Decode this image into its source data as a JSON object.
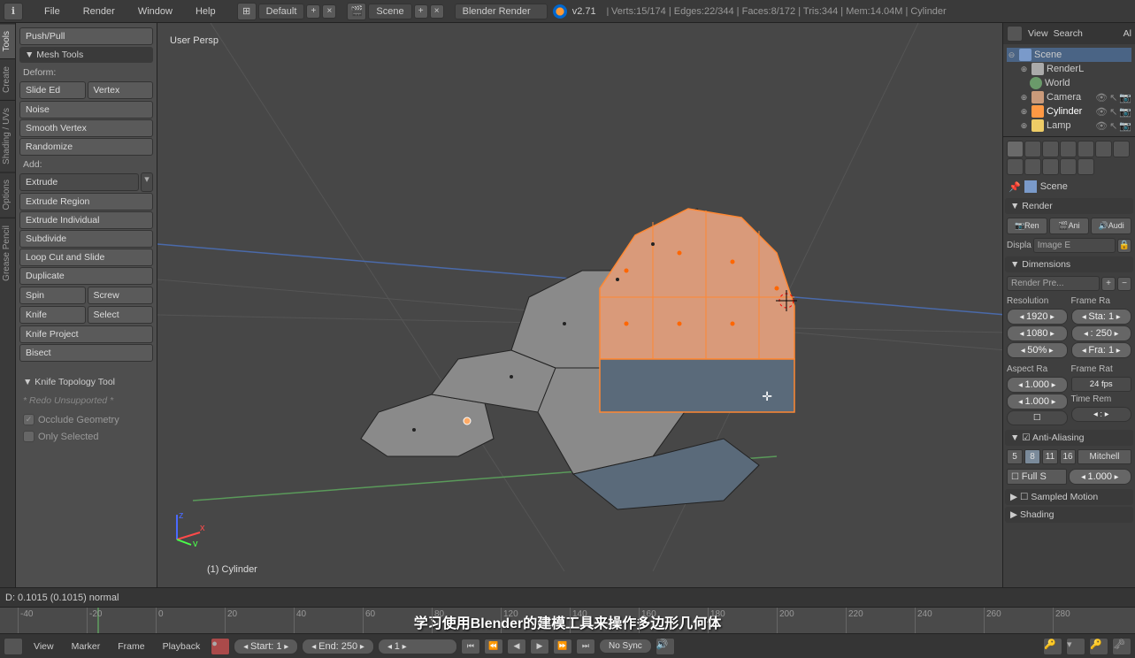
{
  "top": {
    "menus": [
      "File",
      "Render",
      "Window",
      "Help"
    ],
    "layout": "Default",
    "scene": "Scene",
    "renderer": "Blender Render",
    "version": "v2.71",
    "stats": "Verts:15/174 | Edges:22/344 | Faces:8/172 | Tris:344 | Mem:14.04M | Cylinder"
  },
  "leftTabs": [
    "Tools",
    "Create",
    "Shading / UVs",
    "Options",
    "Grease Pencil"
  ],
  "toolPanel": {
    "pushpull": "Push/Pull",
    "meshTools": "▼ Mesh Tools",
    "deform": "Deform:",
    "slideEd": "Slide Ed",
    "vertex": "Vertex",
    "noise": "Noise",
    "smoothVertex": "Smooth Vertex",
    "randomize": "Randomize",
    "add": "Add:",
    "extrude": "Extrude",
    "extrudeRegion": "Extrude Region",
    "extrudeIndividual": "Extrude Individual",
    "subdivide": "Subdivide",
    "loopCut": "Loop Cut and Slide",
    "duplicate": "Duplicate",
    "spin": "Spin",
    "screw": "Screw",
    "knife": "Knife",
    "select": "Select",
    "knifeProject": "Knife Project",
    "bisect": "Bisect",
    "knifeTopo": "▼ Knife Topology Tool",
    "redoUnsupported": "* Redo Unsupported *",
    "occlude": "Occlude Geometry",
    "onlySelected": "Only Selected"
  },
  "viewport": {
    "persp": "User Persp",
    "objLabel": "(1) Cylinder",
    "dStatus": "D: 0.1015 (0.1015) normal"
  },
  "outliner": {
    "view": "View",
    "search": "Search",
    "scene": "Scene",
    "renderL": "RenderL",
    "world": "World",
    "camera": "Camera",
    "cylinder": "Cylinder",
    "lamp": "Lamp"
  },
  "props": {
    "sceneLabel": "Scene",
    "renderHead": "▼ Render",
    "ren": "📷Ren",
    "ani": "🎬Ani",
    "audi": "🔊Audi",
    "displa": "Displa",
    "imageE": "Image E",
    "dimensions": "▼ Dimensions",
    "renderPre": "Render Pre...",
    "resolution": "Resolution",
    "frameRa": "Frame Ra",
    "res_x": "1920",
    "res_y": "1080",
    "res_pct": "50%",
    "sta": "Sta: 1",
    "end250": ": 250",
    "fra": "Fra: 1",
    "aspectRa": "Aspect Ra",
    "frameRat": "Frame Rat",
    "asp_x": "1.000",
    "asp_y": "1.000",
    "fps": "24 fps",
    "timeRem": "Time Rem",
    "antiAliasing": "▼ ☑ Anti-Aliasing",
    "aa5": "5",
    "aa8": "8",
    "aa11": "11",
    "aa16": "16",
    "mitchell": "Mitchell",
    "fullS": "Full S",
    "fullSVal": "1.000",
    "sampledMotion": "▶ ☐ Sampled Motion",
    "shading": "▶ Shading"
  },
  "timeline": {
    "ticks": [
      "-40",
      "-20",
      "0",
      "20",
      "40",
      "60",
      "80",
      "120",
      "140",
      "160",
      "180",
      "200",
      "220",
      "240",
      "260",
      "280"
    ],
    "subtitle": "学习使用Blender的建模工具来操作多边形几何体"
  },
  "bottom": {
    "menus": [
      "View",
      "Marker",
      "Frame",
      "Playback"
    ],
    "start": "Start: 1",
    "end": "End: 250",
    "frame": "1",
    "noSync": "No Sync"
  }
}
